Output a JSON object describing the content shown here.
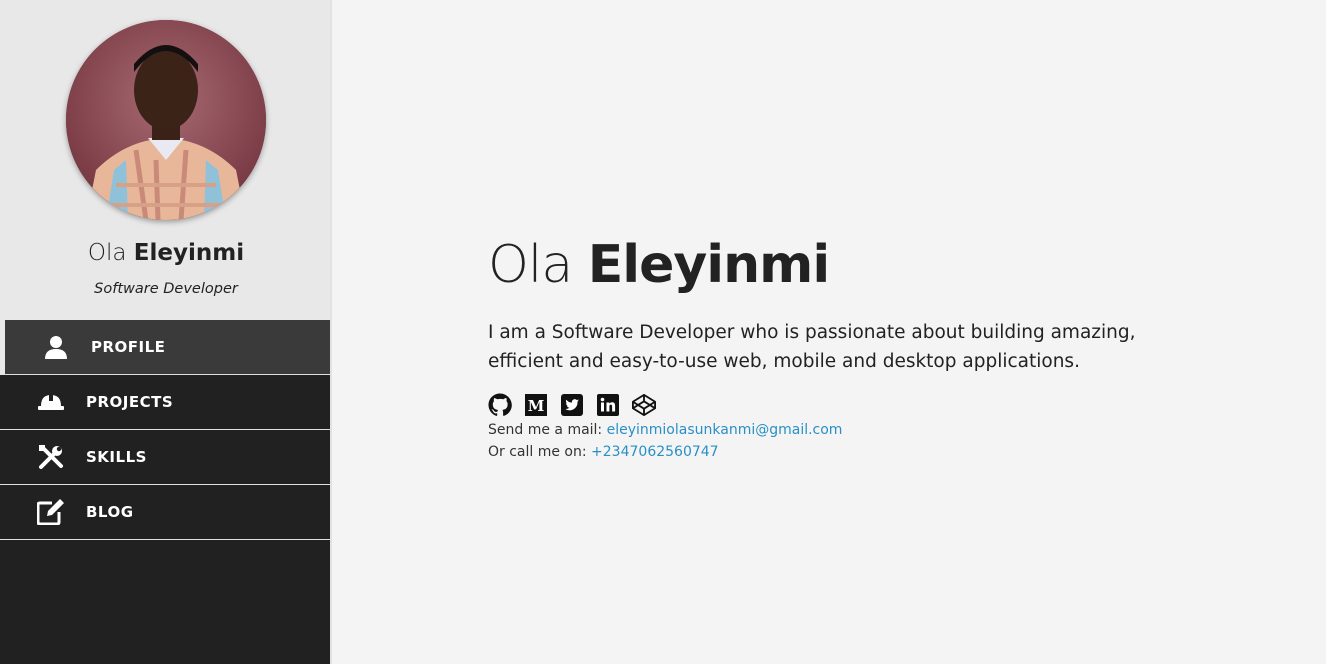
{
  "sidebar": {
    "first_name": "Ola",
    "last_name": "Eleyinmi",
    "role": "Software Developer",
    "nav": [
      {
        "label": "PROFILE",
        "icon": "user-icon",
        "active": true
      },
      {
        "label": "PROJECTS",
        "icon": "hard-hat-icon",
        "active": false
      },
      {
        "label": "SKILLS",
        "icon": "tools-icon",
        "active": false
      },
      {
        "label": "BLOG",
        "icon": "edit-icon",
        "active": false
      }
    ]
  },
  "main": {
    "first_name": "Ola",
    "last_name": "Eleyinmi",
    "bio": "I am a Software Developer who is passionate about building amazing, efficient and easy-to-use web, mobile and desktop applications.",
    "socials": [
      "github-icon",
      "medium-icon",
      "twitter-icon",
      "linkedin-icon",
      "codepen-icon"
    ],
    "mail_label": "Send me a mail:",
    "mail": "eleyinmiolasunkanmi@gmail.com",
    "call_label": "Or call me on:",
    "phone": "+2347062560747"
  },
  "colors": {
    "sidebar_dark": "#212121",
    "sidebar_active": "#3a3a3a",
    "sidebar_top": "#e8e8e8",
    "page_bg": "#f4f4f4",
    "link": "#2a8fc6"
  }
}
